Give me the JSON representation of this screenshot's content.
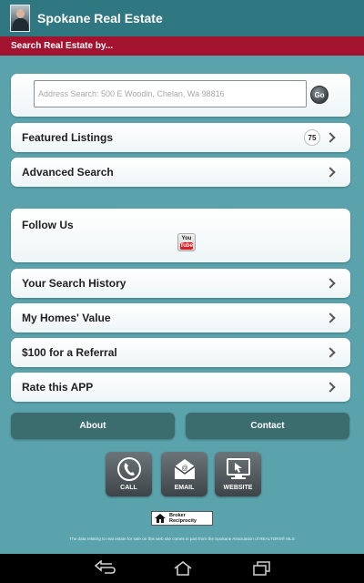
{
  "app": {
    "title": "Spokane Real Estate"
  },
  "search_bar": {
    "heading": "Search Real Estate by...",
    "placeholder": "Address Search: 500 E Woodin, Chelan, Wa 98816",
    "go_label": "Go"
  },
  "menu": {
    "featured": {
      "label": "Featured Listings",
      "count": "75"
    },
    "advanced": {
      "label": "Advanced Search"
    },
    "follow": {
      "label": "Follow Us",
      "youtube_top": "You",
      "youtube_bottom": "Tube"
    },
    "history": {
      "label": "Your Search History"
    },
    "value": {
      "label": "My Homes' Value"
    },
    "referral": {
      "label": "$100 for a Referral"
    },
    "rate": {
      "label": "Rate this APP"
    }
  },
  "buttons": {
    "about": "About",
    "contact": "Contact"
  },
  "contact_tiles": [
    {
      "label": "CALL",
      "icon": "phone-icon"
    },
    {
      "label": "EMAIL",
      "icon": "email-icon"
    },
    {
      "label": "WEBSITE",
      "icon": "website-icon"
    }
  ],
  "broker": {
    "line1": "Broker",
    "line2": "Reciprocity",
    "icon": "house-icon"
  },
  "disclaimer": "The data relating to real estate for sale on this web site comes in part from the Spokane Association of REALTORS® MLS",
  "colors": {
    "page_bg": "#5aa3ad",
    "appbar": "#2f7882",
    "redbar": "#a3122e",
    "dark_button": "#3b6d6e"
  }
}
